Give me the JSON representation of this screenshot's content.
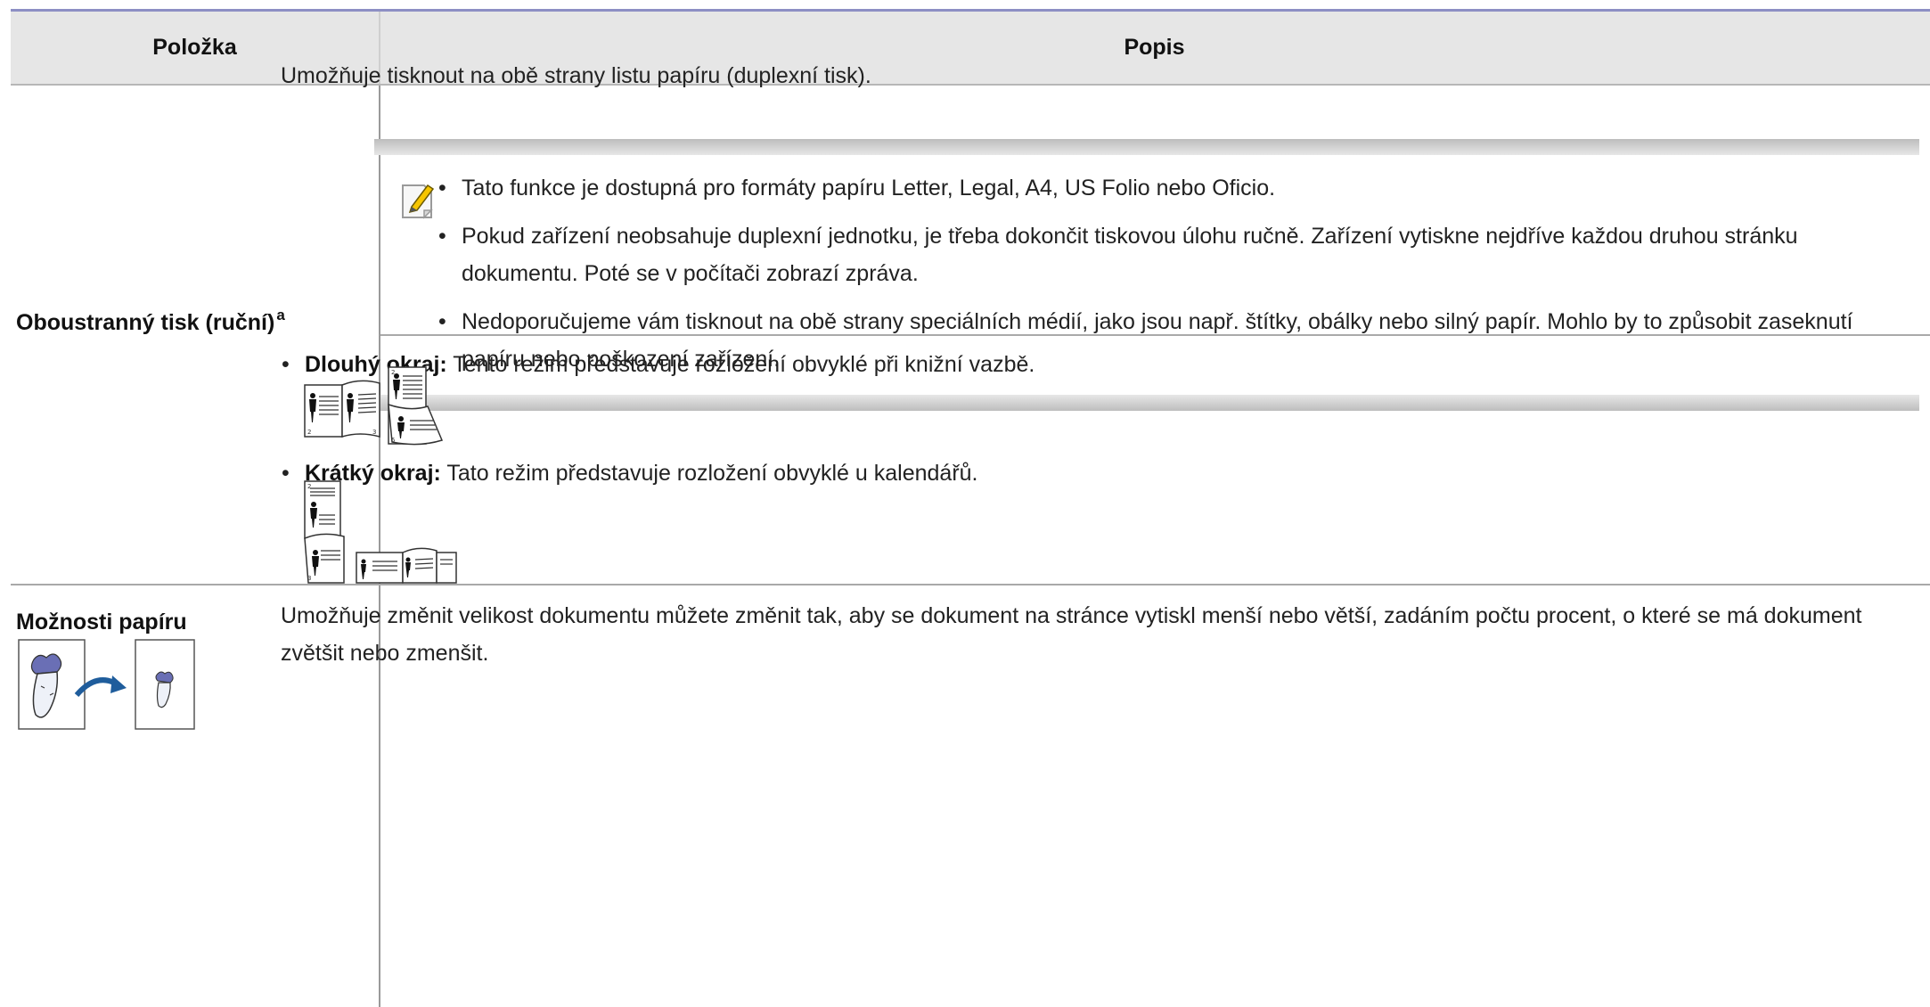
{
  "table": {
    "headers": {
      "item": "Položka",
      "description": "Popis"
    },
    "rows": [
      {
        "item_label": "Oboustranný tisk (ruční)",
        "item_sup": "a",
        "intro": "Umožňuje tisknout na obě strany listu papíru (duplexní tisk).",
        "note_icon": "note-pencil-icon",
        "notes": [
          "Tato funkce je dostupná pro formáty papíru Letter, Legal, A4, US Folio nebo Oficio.",
          "Pokud zařízení neobsahuje duplexní jednotku, je třeba dokončit tiskovou úlohu ručně. Zařízení vytiskne nejdříve každou druhou stránku dokumentu. Poté se v počítači zobrazí zpráva.",
          "Nedoporučujeme vám tisknout na obě strany speciálních médií, jako jsou např. štítky, obálky nebo silný papír. Mohlo by to způsobit zaseknutí papíru nebo poškození zařízení."
        ],
        "options": [
          {
            "term": "Dlouhý okraj:",
            "text": " Tento režim představuje rozložení obvyklé při knižní vazbě.",
            "illustration": "long-edge-binding-illustration"
          },
          {
            "term": "Krátký okraj:",
            "text": " Tato režim představuje rozložení obvyklé u kalendářů.",
            "illustration": "short-edge-binding-illustration"
          }
        ]
      },
      {
        "item_label": "Možnosti papíru",
        "illustration": "paper-scaling-carrot-illustration",
        "description": "Umožňuje změnit velikost dokumentu můžete změnit tak, aby se dokument na stránce vytiskl menší nebo větší, zadáním počtu procent, o které se má dokument zvětšit nebo zmenšit."
      }
    ]
  }
}
